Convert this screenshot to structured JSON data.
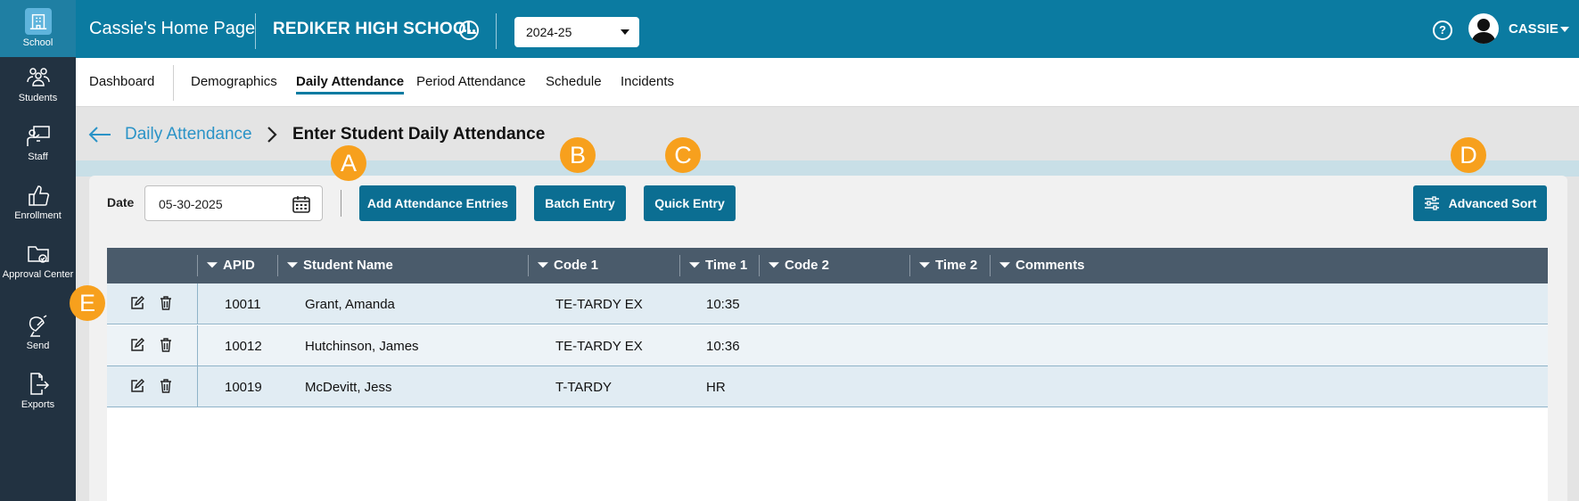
{
  "sidebar": {
    "items": [
      {
        "label": "School",
        "icon": "school-icon"
      },
      {
        "label": "Students",
        "icon": "students-icon"
      },
      {
        "label": "Staff",
        "icon": "staff-icon"
      },
      {
        "label": "Enrollment",
        "icon": "thumbs-up-icon"
      },
      {
        "label": "Approval Center",
        "icon": "folder-check-icon"
      },
      {
        "label": "Send",
        "icon": "satellite-dish-icon"
      },
      {
        "label": "Exports",
        "icon": "export-icon"
      }
    ]
  },
  "header": {
    "home_title": "Cassie's Home Page",
    "school_name": "REDIKER HIGH SCHOOL",
    "year": "2024-25",
    "user": "CASSIE",
    "help_glyph": "?"
  },
  "tabs": [
    {
      "label": "Dashboard"
    },
    {
      "label": "Demographics"
    },
    {
      "label": "Daily Attendance",
      "active": true
    },
    {
      "label": "Period Attendance"
    },
    {
      "label": "Schedule"
    },
    {
      "label": "Incidents"
    }
  ],
  "breadcrumb": {
    "parent": "Daily Attendance",
    "current": "Enter Student Daily Attendance"
  },
  "toolbar": {
    "date_label": "Date",
    "date_value": "05-30-2025",
    "add_label": "Add Attendance Entries",
    "batch_label": "Batch Entry",
    "quick_label": "Quick Entry",
    "sort_label": "Advanced Sort"
  },
  "table": {
    "columns": [
      "APID",
      "Student Name",
      "Code 1",
      "Time 1",
      "Code 2",
      "Time 2",
      "Comments"
    ],
    "rows": [
      {
        "apid": "10011",
        "name": "Grant, Amanda",
        "code1": "TE-TARDY EX",
        "time1": "10:35",
        "code2": "",
        "time2": "",
        "comments": ""
      },
      {
        "apid": "10012",
        "name": "Hutchinson, James",
        "code1": "TE-TARDY EX",
        "time1": "10:36",
        "code2": "",
        "time2": "",
        "comments": ""
      },
      {
        "apid": "10019",
        "name": "McDevitt, Jess",
        "code1": "T-TARDY",
        "time1": "HR",
        "code2": "",
        "time2": "",
        "comments": ""
      }
    ]
  },
  "callouts": {
    "a": "A",
    "b": "B",
    "c": "C",
    "d": "D",
    "e": "E"
  },
  "colors": {
    "brand": "#0b7ba1",
    "sidebar": "#223241",
    "button": "#0b6e92",
    "callout": "#f7a01d",
    "link": "#2a93c7"
  }
}
